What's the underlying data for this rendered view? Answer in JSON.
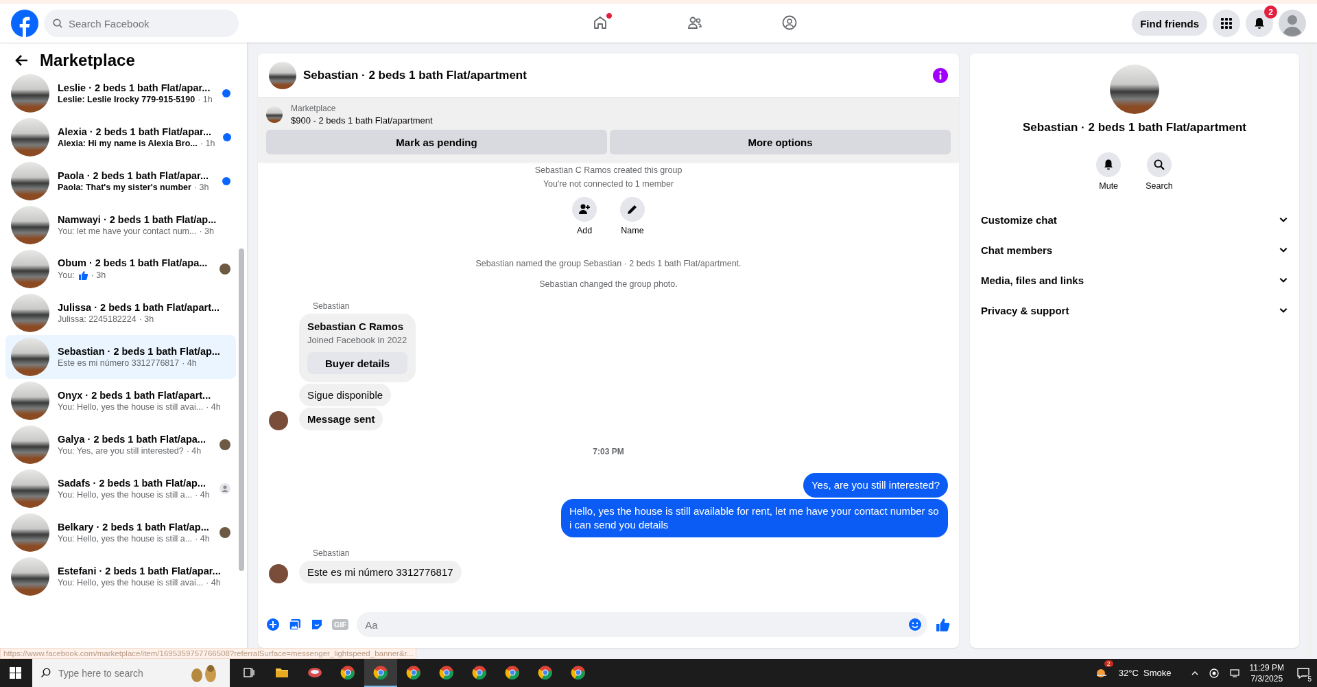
{
  "topbar": {
    "search": {
      "placeholder": "Search Facebook"
    },
    "nav": [
      {
        "kind": "home",
        "selected": false,
        "badge_dot": true
      },
      {
        "kind": "friends",
        "selected": false,
        "badge_dot": false
      },
      {
        "kind": "groups",
        "selected": false,
        "badge_dot": false
      }
    ],
    "find_friends": "Find friends",
    "notifications_count": "2"
  },
  "sidebar": {
    "title": "Marketplace",
    "items": [
      {
        "kind": "unread",
        "name": "Leslie · 2 beds 1 bath Flat/apar...",
        "preview": "Leslie: Leslie Irocky 779-915-5190",
        "time": "· 1h",
        "unread": true,
        "selected": false
      },
      {
        "kind": "unread",
        "name": "Alexia · 2 beds 1 bath Flat/apar...",
        "preview": "Alexia: Hi my name is Alexia Bro...",
        "time": "· 1h",
        "unread": true,
        "selected": false
      },
      {
        "kind": "unread",
        "name": "Paola · 2 beds 1 bath Flat/apar...",
        "preview": "Paola: That's my sister's number",
        "time": "· 3h",
        "unread": true,
        "selected": false
      },
      {
        "kind": "plain",
        "name": "Namwayi · 2 beds 1 bath Flat/ap...",
        "preview": "You: let me have your contact num...",
        "time": "· 3h",
        "unread": false,
        "selected": false
      },
      {
        "kind": "seen",
        "name": "Obum · 2 beds 1 bath Flat/apa...",
        "preview": "You:",
        "like": true,
        "time": "· 3h",
        "unread": false,
        "selected": false
      },
      {
        "kind": "plain",
        "name": "Julissa · 2 beds 1 bath Flat/apart...",
        "preview": "Julissa: 2245182224",
        "time": "· 3h",
        "unread": false,
        "selected": false
      },
      {
        "kind": "plain",
        "name": "Sebastian · 2 beds 1 bath Flat/ap...",
        "preview": "Este es mi número 3312776817",
        "time": "· 4h",
        "unread": false,
        "selected": true
      },
      {
        "kind": "plain",
        "name": "Onyx · 2 beds 1 bath Flat/apart...",
        "preview": "You: Hello, yes the house is still avai...",
        "time": "· 4h",
        "unread": false,
        "selected": false
      },
      {
        "kind": "seen",
        "name": "Galya · 2 beds 1 bath Flat/apa...",
        "preview": "You: Yes, are you still interested?",
        "time": "· 4h",
        "unread": false,
        "selected": false
      },
      {
        "kind": "seen_default",
        "name": "Sadafs · 2 beds 1 bath Flat/ap...",
        "preview": "You: Hello, yes the house is still a...",
        "time": "· 4h",
        "unread": false,
        "selected": false
      },
      {
        "kind": "seen",
        "name": "Belkary · 2 beds 1 bath Flat/ap...",
        "preview": "You: Hello, yes the house is still a...",
        "time": "· 4h",
        "unread": false,
        "selected": false
      },
      {
        "kind": "plain",
        "name": "Estefani · 2 beds 1 bath Flat/apar...",
        "preview": "You: Hello, yes the house is still avai...",
        "time": "· 4h",
        "unread": false,
        "selected": false
      }
    ]
  },
  "chat": {
    "title": "Sebastian · 2 beds 1 bath Flat/apartment",
    "listing": {
      "label": "Marketplace",
      "text": "$900 - 2 beds 1 bath Flat/apartment"
    },
    "buttons": [
      "Mark as pending",
      "More options"
    ],
    "messages": [
      {
        "kind": "system",
        "text": "Sebastian C Ramos created this group"
      },
      {
        "kind": "system",
        "text": "You're not connected to 1 member"
      },
      {
        "kind": "actions",
        "items": [
          "Add",
          "Name"
        ]
      },
      {
        "kind": "system",
        "text": "Sebastian named the group Sebastian · 2 beds 1 bath Flat/apartment."
      },
      {
        "kind": "system",
        "text": "Sebastian changed the group photo."
      },
      {
        "kind": "sender",
        "text": "Sebastian"
      },
      {
        "kind": "profile",
        "name": "Sebastian C Ramos",
        "sub": "Joined Facebook in 2022",
        "button": "Buyer details"
      },
      {
        "kind": "incoming",
        "text": "Sigue disponible",
        "avatar": false,
        "bold": false
      },
      {
        "kind": "incoming",
        "text": "Message sent",
        "avatar": true,
        "bold": true
      },
      {
        "kind": "time",
        "text": "7:03 PM"
      },
      {
        "kind": "outgoing",
        "text": "Yes, are you still interested?"
      },
      {
        "kind": "outgoing",
        "text": "Hello, yes the house is still available for rent, let me have your contact number so i can send you details"
      },
      {
        "kind": "sender",
        "text": "Sebastian"
      },
      {
        "kind": "incoming",
        "text": "Este es mi número 3312776817",
        "avatar": true,
        "bold": false
      }
    ],
    "composer": {
      "placeholder": "Aa",
      "gif": "GIF"
    }
  },
  "details": {
    "title": "Sebastian · 2 beds 1 bath Flat/apartment",
    "actions": [
      {
        "kind": "mute",
        "label": "Mute"
      },
      {
        "kind": "search",
        "label": "Search"
      }
    ],
    "sections": [
      {
        "label": "Customize chat",
        "expanded": false
      },
      {
        "label": "Chat members",
        "expanded": false
      },
      {
        "label": "Media, files and links",
        "expanded": false
      },
      {
        "label": "Privacy & support",
        "expanded": false
      }
    ]
  },
  "status_url": "https://www.facebook.com/marketplace/item/1695359757766508?referralSurface=messenger_lightspeed_banner&r...",
  "taskbar": {
    "search": {
      "placeholder": "Type here to search"
    },
    "apps": [
      {
        "kind": "taskview",
        "selected": false
      },
      {
        "kind": "explorer",
        "selected": false
      },
      {
        "kind": "app",
        "selected": false
      },
      {
        "kind": "chrome",
        "selected": false
      },
      {
        "kind": "chrome",
        "selected": true
      },
      {
        "kind": "chrome",
        "selected": false
      },
      {
        "kind": "chrome",
        "selected": false
      },
      {
        "kind": "chrome",
        "selected": false
      },
      {
        "kind": "chrome",
        "selected": false
      },
      {
        "kind": "chrome",
        "selected": false
      },
      {
        "kind": "chrome",
        "selected": false
      }
    ],
    "weather_badge": "2",
    "weather": "32°C  Smoke",
    "time": "11:29 PM",
    "date": "7/3/2025",
    "notifications": "5"
  }
}
